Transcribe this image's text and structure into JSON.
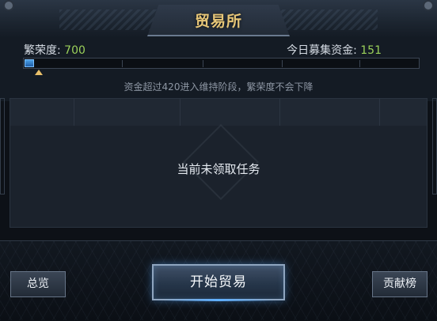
{
  "header": {
    "title": "贸易所"
  },
  "stats": {
    "prosperity_label": "繁荣度:",
    "prosperity_value": "700",
    "funds_label": "今日募集资金:",
    "funds_value": "151",
    "progress_fraction": 0.02,
    "hint": "资金超过420进入维持阶段，繁荣度不会下降"
  },
  "panel": {
    "empty_text": "当前未领取任务"
  },
  "footer": {
    "overview_label": "总览",
    "start_trade_label": "开始贸易",
    "contribution_label": "贡献榜"
  },
  "colors": {
    "accent_value": "#9bd15a",
    "title": "#e8c778",
    "progress": "#4b9fe6"
  }
}
